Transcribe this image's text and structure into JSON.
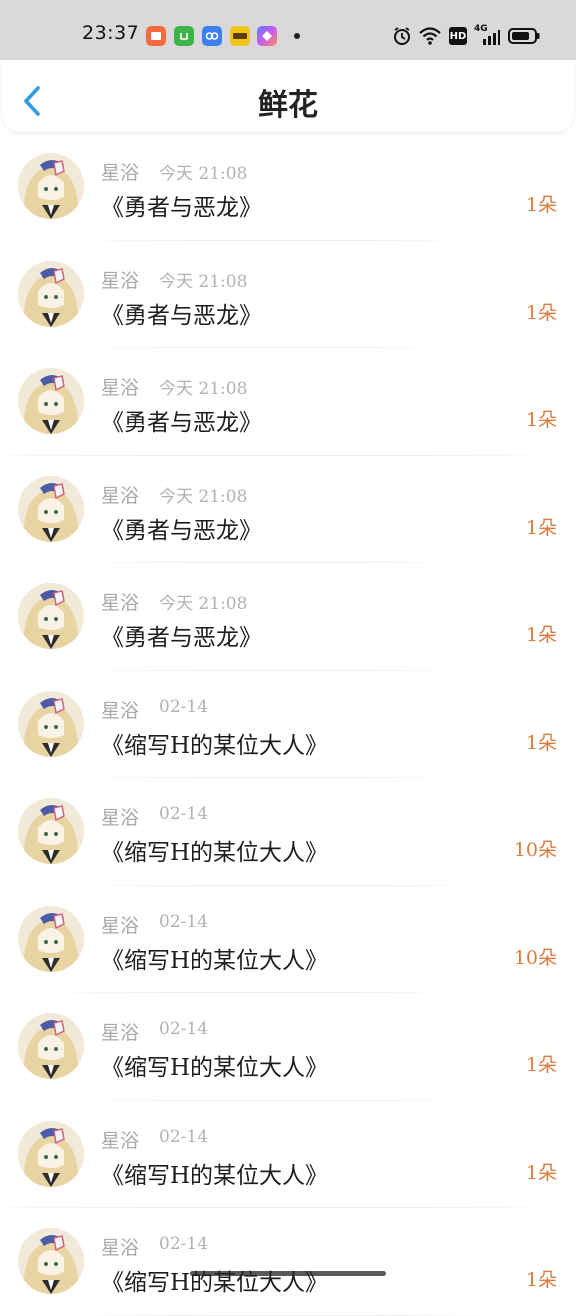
{
  "status_bar": {
    "time": "23:37",
    "network": "4G",
    "hd": "HD",
    "icons": [
      "mail-app-icon",
      "green-app-icon",
      "link-app-icon",
      "yellow-app-icon",
      "gallery-app-icon",
      "alarm-icon",
      "wifi-icon",
      "signal-icon",
      "battery-icon"
    ]
  },
  "header": {
    "title": "鲜花",
    "back_icon": "chevron-left-icon"
  },
  "colors": {
    "accent": "#2f9be6",
    "count": "#e07b3c",
    "meta": "#b2b2b2",
    "title": "#1e1e1e"
  },
  "items": [
    {
      "user": "星浴",
      "time": "今天 21:08",
      "book": "《勇者与恶龙》",
      "count": "1朵"
    },
    {
      "user": "星浴",
      "time": "今天 21:08",
      "book": "《勇者与恶龙》",
      "count": "1朵"
    },
    {
      "user": "星浴",
      "time": "今天 21:08",
      "book": "《勇者与恶龙》",
      "count": "1朵"
    },
    {
      "user": "星浴",
      "time": "今天 21:08",
      "book": "《勇者与恶龙》",
      "count": "1朵"
    },
    {
      "user": "星浴",
      "time": "今天 21:08",
      "book": "《勇者与恶龙》",
      "count": "1朵"
    },
    {
      "user": "星浴",
      "time": "02-14",
      "book": "《缩写H的某位大人》",
      "count": "1朵"
    },
    {
      "user": "星浴",
      "time": "02-14",
      "book": "《缩写H的某位大人》",
      "count": "10朵"
    },
    {
      "user": "星浴",
      "time": "02-14",
      "book": "《缩写H的某位大人》",
      "count": "10朵"
    },
    {
      "user": "星浴",
      "time": "02-14",
      "book": "《缩写H的某位大人》",
      "count": "1朵"
    },
    {
      "user": "星浴",
      "time": "02-14",
      "book": "《缩写H的某位大人》",
      "count": "1朵"
    },
    {
      "user": "星浴",
      "time": "02-14",
      "book": "《缩写H的某位大人》",
      "count": "1朵"
    }
  ]
}
